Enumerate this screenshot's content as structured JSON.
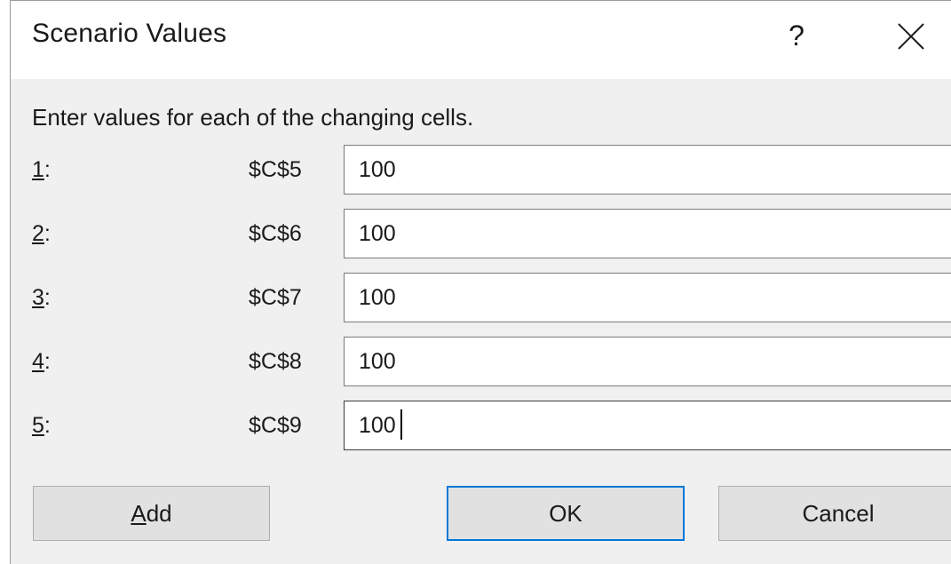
{
  "dialog": {
    "title": "Scenario Values",
    "help_glyph": "?",
    "close_icon": "close-icon",
    "instruction": "Enter values for each of the changing cells.",
    "rows": [
      {
        "num": "1",
        "suffix": ":",
        "cell": "$C$5",
        "value": "100"
      },
      {
        "num": "2",
        "suffix": ":",
        "cell": "$C$6",
        "value": "100"
      },
      {
        "num": "3",
        "suffix": ":",
        "cell": "$C$7",
        "value": "100"
      },
      {
        "num": "4",
        "suffix": ":",
        "cell": "$C$8",
        "value": "100"
      },
      {
        "num": "5",
        "suffix": ":",
        "cell": "$C$9",
        "value": "100"
      }
    ],
    "buttons": {
      "add_mnemonic": "A",
      "add_rest": "dd",
      "ok": "OK",
      "cancel": "Cancel"
    },
    "colors": {
      "default_button_border": "#0078d7",
      "dialog_background": "#f0f0f0"
    }
  }
}
